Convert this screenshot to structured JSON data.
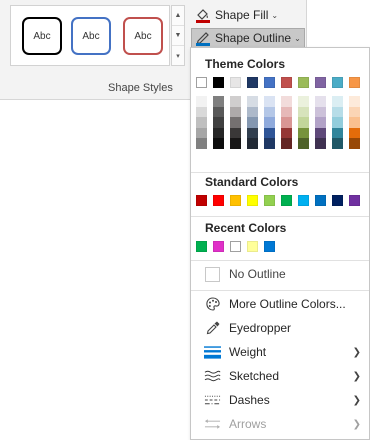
{
  "ribbon": {
    "group_label": "Shape Styles",
    "style_swatches": [
      {
        "label": "Abc",
        "border": "#000000"
      },
      {
        "label": "Abc",
        "border": "#4472c4"
      },
      {
        "label": "Abc",
        "border": "#c00000"
      }
    ],
    "shape_fill": {
      "label": "Shape Fill",
      "icon": "paint-bucket-icon",
      "accent": "#c00000"
    },
    "shape_outline": {
      "label": "Shape Outline",
      "icon": "pen-icon",
      "accent": "#0070c0"
    }
  },
  "panel": {
    "theme_colors_header": "Theme Colors",
    "theme_colors": [
      "#ffffff",
      "#000000",
      "#e7e6e6",
      "#44546a",
      "#4472c4",
      "#ed7d31",
      "#a5a5a5",
      "#ffc000",
      "#5b9bd5",
      "#70ad47"
    ],
    "theme_colors_displayed": [
      "#ffffff",
      "#000000",
      "#e7e6e6",
      "#1f3864",
      "#4472c4",
      "#c0504d",
      "#9bbb59",
      "#8064a2",
      "#4bacc6",
      "#f79646"
    ],
    "theme_shades": [
      [
        "#f2f2f2",
        "#d9d9d9",
        "#bfbfbf",
        "#a6a6a6",
        "#808080"
      ],
      [
        "#7f7f7f",
        "#595959",
        "#404040",
        "#262626",
        "#0d0d0d"
      ],
      [
        "#d0cece",
        "#aeaaaa",
        "#757171",
        "#3a3838",
        "#171616"
      ],
      [
        "#d6dce4",
        "#adb9ca",
        "#8497b0",
        "#323f4f",
        "#222a35"
      ],
      [
        "#dae3f3",
        "#b4c7e7",
        "#8faadc",
        "#2f5597",
        "#1f3864"
      ],
      [
        "#f2dcdb",
        "#e6b9b8",
        "#d99694",
        "#953735",
        "#632523"
      ],
      [
        "#ebf1dd",
        "#d7e3bc",
        "#c3d69b",
        "#77933c",
        "#4f6228"
      ],
      [
        "#e5e0ec",
        "#ccc1d9",
        "#b2a2c7",
        "#5f497a",
        "#3f3151"
      ],
      [
        "#dbeef3",
        "#b7dde8",
        "#92cddc",
        "#31859b",
        "#205867"
      ],
      [
        "#fdeada",
        "#fbd5b5",
        "#fac08f",
        "#e46c0a",
        "#984806"
      ]
    ],
    "standard_colors_header": "Standard Colors",
    "standard_colors": [
      "#c00000",
      "#ff0000",
      "#ffc000",
      "#ffff00",
      "#92d050",
      "#00b050",
      "#00b0f0",
      "#0070c0",
      "#002060",
      "#7030a0"
    ],
    "recent_colors_header": "Recent Colors",
    "recent_colors": [
      "#00b050",
      "#e030c8",
      "#ffffff",
      "#ffff99",
      "#0078d4"
    ],
    "no_outline": "No Outline",
    "menu_items": [
      {
        "label": "More Outline Colors...",
        "icon": "palette-icon",
        "has_arrow": false,
        "disabled": false
      },
      {
        "label": "Eyedropper",
        "icon": "eyedropper-icon",
        "has_arrow": false,
        "disabled": false
      },
      {
        "label": "Weight",
        "icon": "weight-icon",
        "has_arrow": true,
        "disabled": false
      },
      {
        "label": "Sketched",
        "icon": "sketched-icon",
        "has_arrow": true,
        "disabled": false
      },
      {
        "label": "Dashes",
        "icon": "dashes-icon",
        "has_arrow": true,
        "disabled": false
      },
      {
        "label": "Arrows",
        "icon": "arrows-icon",
        "has_arrow": true,
        "disabled": true
      }
    ]
  }
}
